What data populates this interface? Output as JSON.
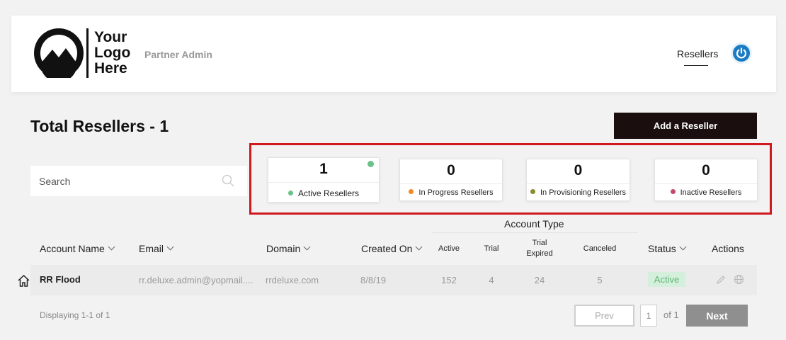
{
  "header": {
    "logo_text": [
      "Your",
      "Logo",
      "Here"
    ],
    "app_name": "Partner Admin",
    "nav_item": "Resellers",
    "power_icon": "power-icon"
  },
  "page": {
    "title": "Total Resellers - 1",
    "add_button": "Add a Reseller",
    "search_placeholder": "Search"
  },
  "stats": [
    {
      "value": "1",
      "label": "Active Resellers",
      "color": "#6cc18a"
    },
    {
      "value": "0",
      "label": "In Progress Resellers",
      "color": "#f08a24"
    },
    {
      "value": "0",
      "label": "In Provisioning Resellers",
      "color": "#8a8a2e"
    },
    {
      "value": "0",
      "label": "Inactive Resellers",
      "color": "#c24a6a"
    }
  ],
  "table": {
    "headers": {
      "account_name": "Account Name",
      "email": "Email",
      "domain": "Domain",
      "created_on": "Created On",
      "account_type": "Account Type",
      "active": "Active",
      "trial": "Trial",
      "trial_expired": "Trial Expired",
      "canceled": "Canceled",
      "status": "Status",
      "actions": "Actions"
    },
    "rows": [
      {
        "account_name": "RR Flood",
        "email": "rr.deluxe.admin@yopmail....",
        "domain": "rrdeluxe.com",
        "created_on": "8/8/19",
        "active": "152",
        "trial": "4",
        "trial_expired": "24",
        "canceled": "5",
        "status": "Active"
      }
    ]
  },
  "pagination": {
    "display_text": "Displaying 1-1 of 1",
    "prev": "Prev",
    "page": "1",
    "of_text": "of 1",
    "next": "Next"
  }
}
